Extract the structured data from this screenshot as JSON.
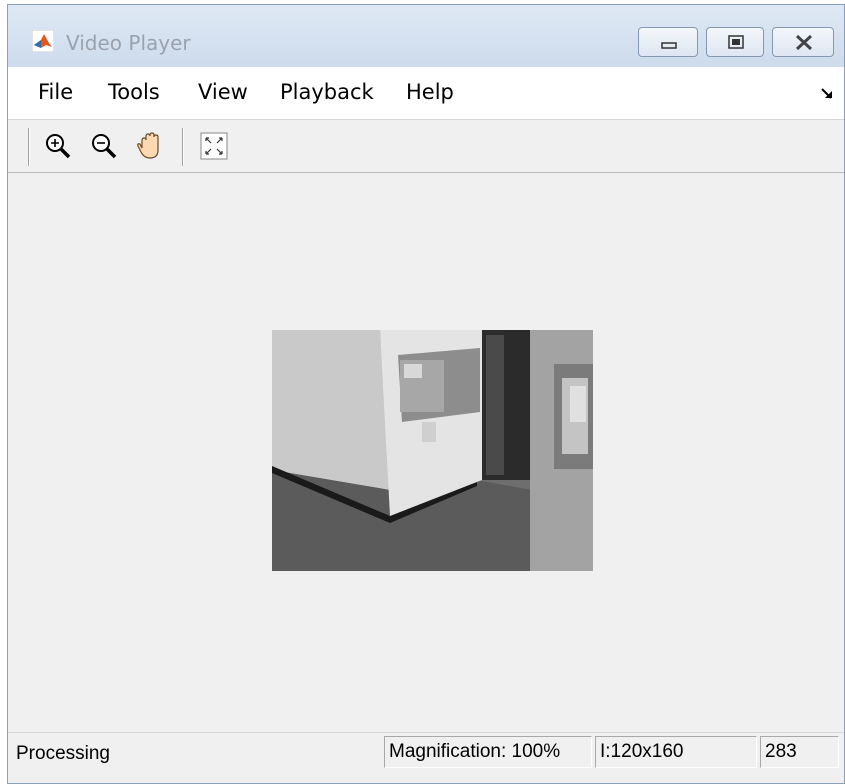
{
  "window": {
    "title": "Video Player"
  },
  "titlebar": {
    "icon": "matlab-logo-icon",
    "buttons": [
      "minimize-icon",
      "maximize-icon",
      "close-icon"
    ]
  },
  "menu": {
    "file": "File",
    "tools": "Tools",
    "view": "View",
    "playback": "Playback",
    "help": "Help"
  },
  "toolbar": {
    "icons": [
      "zoom-in-icon",
      "zoom-out-icon",
      "pan-hand-icon",
      "fit-to-window-icon"
    ]
  },
  "status": {
    "text": "Processing",
    "magnification": "Magnification: 100%",
    "dimensions": "I:120x160",
    "frame": "283"
  },
  "colors": {
    "window_bg": "#f0f0f0",
    "titlebar": "#d6e2f0",
    "accent_logo": "#e8561c"
  }
}
